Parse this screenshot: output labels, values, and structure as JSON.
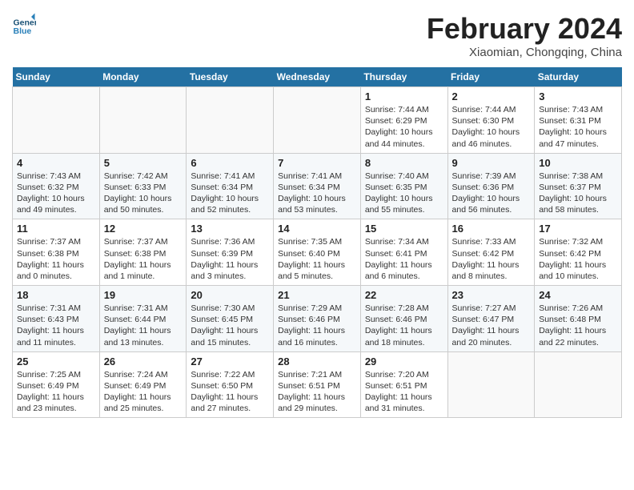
{
  "header": {
    "logo_general": "General",
    "logo_blue": "Blue",
    "month_title": "February 2024",
    "subtitle": "Xiaomian, Chongqing, China"
  },
  "days_of_week": [
    "Sunday",
    "Monday",
    "Tuesday",
    "Wednesday",
    "Thursday",
    "Friday",
    "Saturday"
  ],
  "weeks": [
    [
      {
        "day": "",
        "info": ""
      },
      {
        "day": "",
        "info": ""
      },
      {
        "day": "",
        "info": ""
      },
      {
        "day": "",
        "info": ""
      },
      {
        "day": "1",
        "info": "Sunrise: 7:44 AM\nSunset: 6:29 PM\nDaylight: 10 hours\nand 44 minutes."
      },
      {
        "day": "2",
        "info": "Sunrise: 7:44 AM\nSunset: 6:30 PM\nDaylight: 10 hours\nand 46 minutes."
      },
      {
        "day": "3",
        "info": "Sunrise: 7:43 AM\nSunset: 6:31 PM\nDaylight: 10 hours\nand 47 minutes."
      }
    ],
    [
      {
        "day": "4",
        "info": "Sunrise: 7:43 AM\nSunset: 6:32 PM\nDaylight: 10 hours\nand 49 minutes."
      },
      {
        "day": "5",
        "info": "Sunrise: 7:42 AM\nSunset: 6:33 PM\nDaylight: 10 hours\nand 50 minutes."
      },
      {
        "day": "6",
        "info": "Sunrise: 7:41 AM\nSunset: 6:34 PM\nDaylight: 10 hours\nand 52 minutes."
      },
      {
        "day": "7",
        "info": "Sunrise: 7:41 AM\nSunset: 6:34 PM\nDaylight: 10 hours\nand 53 minutes."
      },
      {
        "day": "8",
        "info": "Sunrise: 7:40 AM\nSunset: 6:35 PM\nDaylight: 10 hours\nand 55 minutes."
      },
      {
        "day": "9",
        "info": "Sunrise: 7:39 AM\nSunset: 6:36 PM\nDaylight: 10 hours\nand 56 minutes."
      },
      {
        "day": "10",
        "info": "Sunrise: 7:38 AM\nSunset: 6:37 PM\nDaylight: 10 hours\nand 58 minutes."
      }
    ],
    [
      {
        "day": "11",
        "info": "Sunrise: 7:37 AM\nSunset: 6:38 PM\nDaylight: 11 hours\nand 0 minutes."
      },
      {
        "day": "12",
        "info": "Sunrise: 7:37 AM\nSunset: 6:38 PM\nDaylight: 11 hours\nand 1 minute."
      },
      {
        "day": "13",
        "info": "Sunrise: 7:36 AM\nSunset: 6:39 PM\nDaylight: 11 hours\nand 3 minutes."
      },
      {
        "day": "14",
        "info": "Sunrise: 7:35 AM\nSunset: 6:40 PM\nDaylight: 11 hours\nand 5 minutes."
      },
      {
        "day": "15",
        "info": "Sunrise: 7:34 AM\nSunset: 6:41 PM\nDaylight: 11 hours\nand 6 minutes."
      },
      {
        "day": "16",
        "info": "Sunrise: 7:33 AM\nSunset: 6:42 PM\nDaylight: 11 hours\nand 8 minutes."
      },
      {
        "day": "17",
        "info": "Sunrise: 7:32 AM\nSunset: 6:42 PM\nDaylight: 11 hours\nand 10 minutes."
      }
    ],
    [
      {
        "day": "18",
        "info": "Sunrise: 7:31 AM\nSunset: 6:43 PM\nDaylight: 11 hours\nand 11 minutes."
      },
      {
        "day": "19",
        "info": "Sunrise: 7:31 AM\nSunset: 6:44 PM\nDaylight: 11 hours\nand 13 minutes."
      },
      {
        "day": "20",
        "info": "Sunrise: 7:30 AM\nSunset: 6:45 PM\nDaylight: 11 hours\nand 15 minutes."
      },
      {
        "day": "21",
        "info": "Sunrise: 7:29 AM\nSunset: 6:46 PM\nDaylight: 11 hours\nand 16 minutes."
      },
      {
        "day": "22",
        "info": "Sunrise: 7:28 AM\nSunset: 6:46 PM\nDaylight: 11 hours\nand 18 minutes."
      },
      {
        "day": "23",
        "info": "Sunrise: 7:27 AM\nSunset: 6:47 PM\nDaylight: 11 hours\nand 20 minutes."
      },
      {
        "day": "24",
        "info": "Sunrise: 7:26 AM\nSunset: 6:48 PM\nDaylight: 11 hours\nand 22 minutes."
      }
    ],
    [
      {
        "day": "25",
        "info": "Sunrise: 7:25 AM\nSunset: 6:49 PM\nDaylight: 11 hours\nand 23 minutes."
      },
      {
        "day": "26",
        "info": "Sunrise: 7:24 AM\nSunset: 6:49 PM\nDaylight: 11 hours\nand 25 minutes."
      },
      {
        "day": "27",
        "info": "Sunrise: 7:22 AM\nSunset: 6:50 PM\nDaylight: 11 hours\nand 27 minutes."
      },
      {
        "day": "28",
        "info": "Sunrise: 7:21 AM\nSunset: 6:51 PM\nDaylight: 11 hours\nand 29 minutes."
      },
      {
        "day": "29",
        "info": "Sunrise: 7:20 AM\nSunset: 6:51 PM\nDaylight: 11 hours\nand 31 minutes."
      },
      {
        "day": "",
        "info": ""
      },
      {
        "day": "",
        "info": ""
      }
    ]
  ]
}
